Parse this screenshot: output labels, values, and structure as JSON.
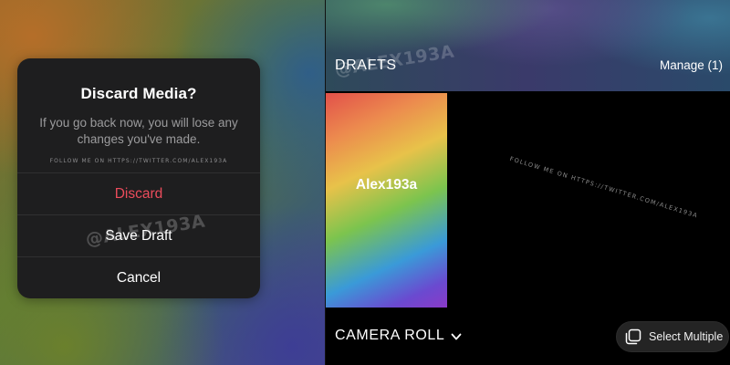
{
  "left": {
    "dialog": {
      "title": "Discard Media?",
      "message": "If you go back now, you will lose any changes you've made.",
      "credit": "FOLLOW ME ON HTTPS://TWITTER.COM/ALEX193A",
      "actions": {
        "discard": "Discard",
        "save_draft": "Save Draft",
        "cancel": "Cancel"
      }
    },
    "watermark": "@ALEX193A"
  },
  "right": {
    "header": {
      "title": "DRAFTS",
      "manage": "Manage (1)"
    },
    "watermark": "@ALEX193A",
    "draft": {
      "label": "Alex193a"
    },
    "credit": "FOLLOW ME ON HTTPS://TWITTER.COM/ALEX193A",
    "footer": {
      "camera_roll": "CAMERA ROLL",
      "select_multiple": "Select Multiple"
    }
  },
  "icons": {
    "camera_roll_dropdown": "chevron-down-icon",
    "select_multiple": "stacked-squares-icon"
  },
  "colors": {
    "destructive": "#ec4c5c",
    "dialog_bg": "#1e1e1f",
    "pill_bg": "#242424"
  }
}
